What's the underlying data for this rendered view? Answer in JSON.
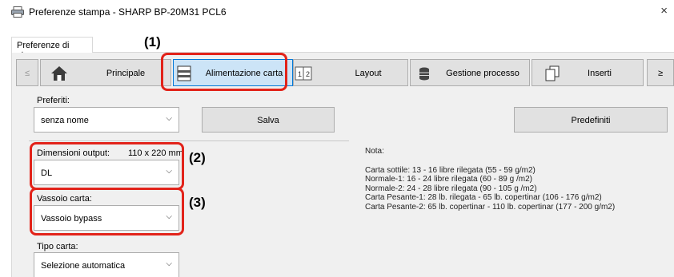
{
  "window": {
    "title": "Preferenze stampa - SHARP BP-20M31 PCL6",
    "close_glyph": "×"
  },
  "tab": {
    "label": "Preferenze di stampa"
  },
  "toolbar": {
    "scroll_left": "≤",
    "scroll_right": "≥",
    "items": [
      {
        "label": "Principale",
        "icon": "home-icon"
      },
      {
        "label": "Alimentazione carta",
        "icon": "paper-tray-icon"
      },
      {
        "label": "Layout",
        "icon": "layout-icon"
      },
      {
        "label": "Gestione processo",
        "icon": "job-handling-icon"
      },
      {
        "label": "Inserti",
        "icon": "inserts-icon"
      }
    ]
  },
  "favorites": {
    "label": "Preferiti:",
    "value": "senza nome",
    "save_label": "Salva",
    "defaults_label": "Predefiniti"
  },
  "output_size": {
    "label": "Dimensioni output:",
    "dimension": "110 x 220 mm",
    "value": "DL"
  },
  "paper_tray": {
    "label": "Vassoio carta:",
    "value": "Vassoio bypass"
  },
  "paper_type": {
    "label": "Tipo carta:",
    "value": "Selezione automatica"
  },
  "note": {
    "title": "Nota:",
    "lines": [
      "Carta sottile: 13 - 16 libre rilegata (55 - 59 g/m2)",
      "Normale-1: 16 - 24 libre rilegata (60 - 89 g /m2)",
      "Normale-2: 24 - 28 libre rilegata (90 - 105 g /m2)",
      "Carta Pesante-1: 28 lb. rilegata - 65 lb. copertinar (106 - 176 g/m2)",
      "Carta Pesante-2: 65 lb. copertinar - 110 lb. copertinar (177 - 200 g/m2)"
    ]
  },
  "callouts": {
    "c1": "(1)",
    "c2": "(2)",
    "c3": "(3)"
  },
  "colors": {
    "highlight": "#e2231a",
    "active_tab": "#cce4f7",
    "active_border": "#0078d7"
  }
}
